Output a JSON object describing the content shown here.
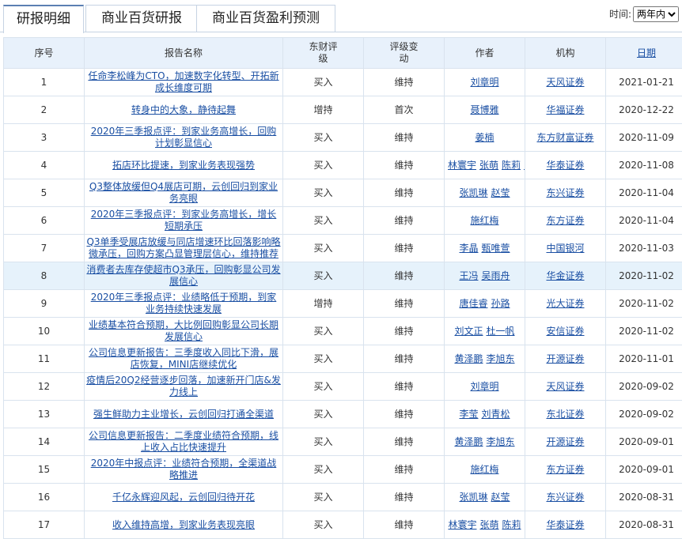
{
  "tabs": [
    "研报明细",
    "商业百货研报",
    "商业百货盈利预测"
  ],
  "time_filter": {
    "label": "时间:",
    "value": "两年内"
  },
  "columns": [
    "序号",
    "报告名称",
    "东财评级",
    "评级变动",
    "作者",
    "机构",
    "日期"
  ],
  "rows": [
    {
      "no": "1",
      "title": "任命李松峰为CTO，加速数字化转型、开拓新成长维度可期",
      "rating": "买入",
      "change": "维持",
      "authors": [
        "刘章明"
      ],
      "org": "天风证券",
      "date": "2021-01-21"
    },
    {
      "no": "2",
      "title": "转身中的大象，静待起舞",
      "rating": "增持",
      "change": "首次",
      "authors": [
        "聂博雅"
      ],
      "org": "华福证券",
      "date": "2020-12-22"
    },
    {
      "no": "3",
      "title": "2020年三季报点评：到家业务高增长，回购计划彰显信心",
      "rating": "买入",
      "change": "维持",
      "authors": [
        "姜楠"
      ],
      "org": "东方财富证券",
      "date": "2020-11-09"
    },
    {
      "no": "4",
      "title": "拓店环比提速，到家业务表现强势",
      "rating": "买入",
      "change": "维持",
      "authors": [
        "林寰宇",
        "张萌",
        "陈莉",
        "张诗宇"
      ],
      "org": "华泰证券",
      "date": "2020-11-08"
    },
    {
      "no": "5",
      "title": "Q3整体放缓但Q4展店可期，云创回归到家业务亮眼",
      "rating": "买入",
      "change": "维持",
      "authors": [
        "张凯琳",
        "赵莹"
      ],
      "org": "东兴证券",
      "date": "2020-11-04"
    },
    {
      "no": "6",
      "title": "2020年三季报点评：到家业务高增长，增长短期承压",
      "rating": "买入",
      "change": "维持",
      "authors": [
        "施红梅"
      ],
      "org": "东方证券",
      "date": "2020-11-04"
    },
    {
      "no": "7",
      "title": "Q3单季受展店放缓与同店增速环比回落影响略微承压，回购方案凸显管理层信心，维持推荐",
      "rating": "买入",
      "change": "维持",
      "authors": [
        "李晶",
        "甄唯萱"
      ],
      "org": "中国银河",
      "date": "2020-11-03"
    },
    {
      "no": "8",
      "title": "消费者去库存使超市Q3承压，回购彰显公司发展信心",
      "rating": "买入",
      "change": "维持",
      "authors": [
        "王冯",
        "吴雨舟"
      ],
      "org": "华金证券",
      "date": "2020-11-02"
    },
    {
      "no": "9",
      "title": "2020年三季报点评：业绩略低于预期，到家业务持续快速发展",
      "rating": "增持",
      "change": "维持",
      "authors": [
        "唐佳睿",
        "孙路"
      ],
      "org": "光大证券",
      "date": "2020-11-02"
    },
    {
      "no": "10",
      "title": "业绩基本符合预期，大比例回购彰显公司长期发展信心",
      "rating": "买入",
      "change": "维持",
      "authors": [
        "刘文正",
        "杜一帆"
      ],
      "org": "安信证券",
      "date": "2020-11-02"
    },
    {
      "no": "11",
      "title": "公司信息更新报告：三季度收入同比下滑，展店恢复，MINI店继续优化",
      "rating": "买入",
      "change": "维持",
      "authors": [
        "黄泽鹏",
        "李旭东"
      ],
      "org": "开源证券",
      "date": "2020-11-01"
    },
    {
      "no": "12",
      "title": "疫情后20Q2经营逐步回落，加速新开门店&发力线上",
      "rating": "买入",
      "change": "维持",
      "authors": [
        "刘章明"
      ],
      "org": "天风证券",
      "date": "2020-09-02"
    },
    {
      "no": "13",
      "title": "强生鲜助力主业增长，云创回归打通全渠道",
      "rating": "买入",
      "change": "维持",
      "authors": [
        "李莹",
        "刘青松"
      ],
      "org": "东北证券",
      "date": "2020-09-02"
    },
    {
      "no": "14",
      "title": "公司信息更新报告：二季度业绩符合预期，线上收入占比快速提升",
      "rating": "买入",
      "change": "维持",
      "authors": [
        "黄泽鹏",
        "李旭东"
      ],
      "org": "开源证券",
      "date": "2020-09-01"
    },
    {
      "no": "15",
      "title": "2020年中报点评：业绩符合预期，全渠道战略推进",
      "rating": "买入",
      "change": "维持",
      "authors": [
        "施红梅"
      ],
      "org": "东方证券",
      "date": "2020-09-01"
    },
    {
      "no": "16",
      "title": "千亿永辉迎风起，云创回归待开花",
      "rating": "买入",
      "change": "维持",
      "authors": [
        "张凯琳",
        "赵莹"
      ],
      "org": "东兴证券",
      "date": "2020-08-31"
    },
    {
      "no": "17",
      "title": "收入维持高增，到家业务表现亮眼",
      "rating": "买入",
      "change": "维持",
      "authors": [
        "林寰宇",
        "张萌",
        "陈莉"
      ],
      "org": "华泰证券",
      "date": "2020-08-31"
    }
  ],
  "highlight_row": 8
}
